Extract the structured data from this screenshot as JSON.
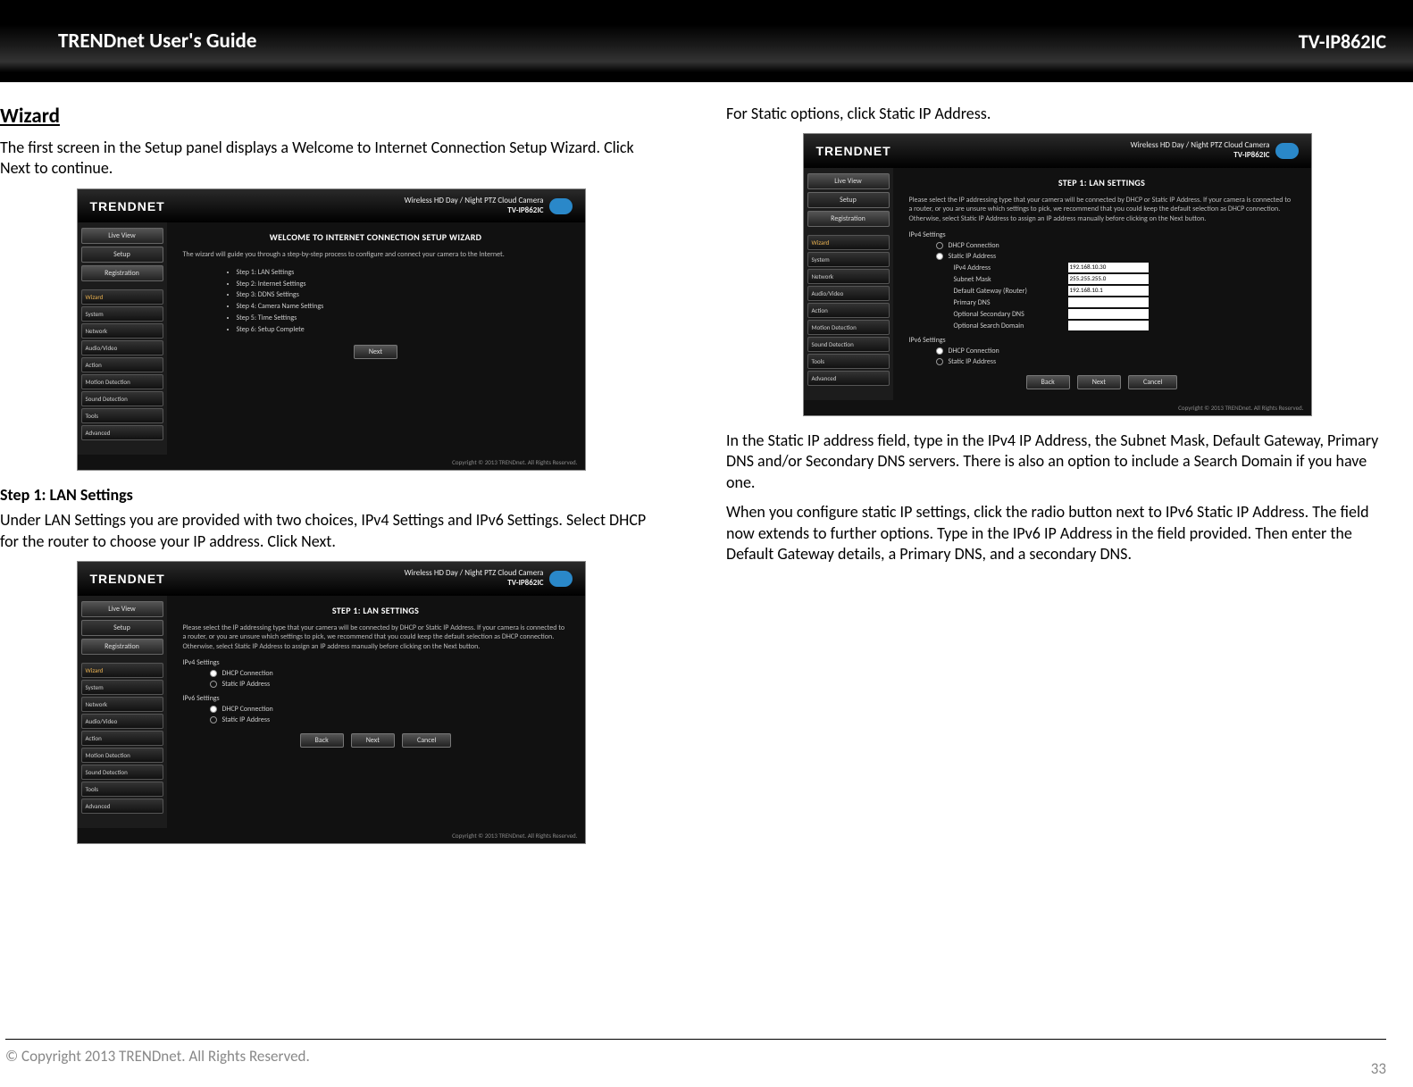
{
  "header": {
    "title": "TRENDnet User's Guide",
    "model": "TV-IP862IC"
  },
  "left": {
    "wizard_heading": "Wizard",
    "intro": "The first screen in the Setup panel displays a Welcome to Internet Connection Setup Wizard. Click Next to continue.",
    "step1_heading": "Step 1: LAN Settings",
    "step1_text": "Under LAN Settings you are provided with two choices, IPv4 Settings and IPv6 Settings. Select DHCP for the router to choose your IP address. Click Next."
  },
  "right": {
    "static_intro": "For Static options, click Static IP Address.",
    "static_p1": "In the Static IP address field, type in the IPv4 IP Address, the Subnet Mask, Default Gateway, Primary DNS and/or Secondary DNS servers. There is also an option to include a Search Domain if you have one.",
    "static_p2": "When you configure static IP settings, click the radio button next to IPv6 Static IP Address. The field now extends to further options. Type in the IPv6 IP Address in the field provided. Then enter the Default Gateway details, a Primary DNS, and a secondary DNS."
  },
  "ss_common": {
    "logo_a": "TREND",
    "logo_b": "NET",
    "product_line1": "Wireless HD Day / Night PTZ Cloud Camera",
    "product_line2": "TV-IP862IC",
    "footer_copy": "Copyright © 2013 TRENDnet. All Rights Reserved.",
    "sidebar_top": [
      "Live View",
      "Setup",
      "Registration"
    ],
    "sidebar_menu": [
      "Wizard",
      "System",
      "Network",
      "Audio/Video",
      "Action",
      "Motion Detection",
      "Sound Detection",
      "Tools",
      "Advanced"
    ]
  },
  "ss1": {
    "title": "WELCOME TO INTERNET CONNECTION SETUP WIZARD",
    "desc": "The wizard will guide you through a step-by-step process to configure and connect your camera to the Internet.",
    "steps": [
      "Step 1: LAN Settings",
      "Step 2: Internet Settings",
      "Step 3: DDNS Settings",
      "Step 4: Camera Name Settings",
      "Step 5: Time Settings",
      "Step 6: Setup Complete"
    ],
    "next_btn": "Next"
  },
  "ss2": {
    "title": "STEP 1: LAN SETTINGS",
    "desc": "Please select the IP addressing type that your camera will be connected by DHCP or Static IP Address. If your camera is connected to a router, or you are unsure which settings to pick, we recommend that you could keep the default selection as DHCP connection. Otherwise, select Static IP Address to assign an IP address manually before clicking on the Next button.",
    "ipv4_label": "IPv4 Settings",
    "ipv6_label": "IPv6 Settings",
    "dhcp": "DHCP Connection",
    "static": "Static IP Address",
    "back": "Back",
    "next": "Next",
    "cancel": "Cancel"
  },
  "ss3": {
    "title": "STEP 1: LAN SETTINGS",
    "desc": "Please select the IP addressing type that your camera will be connected by DHCP or Static IP Address. If your camera is connected to a router, or you are unsure which settings to pick, we recommend that you could keep the default selection as DHCP connection. Otherwise, select Static IP Address to assign an IP address manually before clicking on the Next button.",
    "ipv4_label": "IPv4 Settings",
    "ipv6_label": "IPv6 Settings",
    "dhcp": "DHCP Connection",
    "static": "Static IP Address",
    "fields": {
      "ipv4_addr_label": "IPv4 Address",
      "ipv4_addr": "192.168.10.30",
      "subnet_label": "Subnet Mask",
      "subnet": "255.255.255.0",
      "gateway_label": "Default Gateway (Router)",
      "gateway": "192.168.10.1",
      "pdns_label": "Primary DNS",
      "pdns": "",
      "sdns_label": "Optional Secondary DNS",
      "sdns": "",
      "sdom_label": "Optional Search Domain",
      "sdom": ""
    },
    "back": "Back",
    "next": "Next",
    "cancel": "Cancel"
  },
  "footer": {
    "copyright": "© Copyright 2013 TRENDnet. All Rights Reserved.",
    "page": "33"
  }
}
